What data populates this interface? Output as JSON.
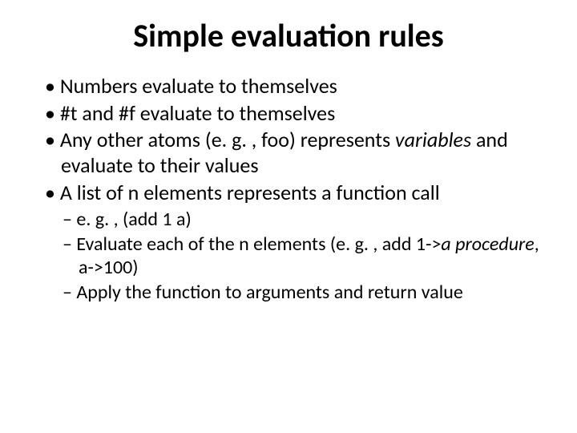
{
  "title": "Simple evaluation rules",
  "bullets": {
    "b0": "Numbers evaluate to themselves",
    "b1": "#t and #f evaluate to themselves",
    "b2_a": "Any other atoms (e. g. , foo) represents ",
    "b2_b": "variables",
    "b2_c": " and evaluate to their values",
    "b3": "A list of n elements represents a function call",
    "s0": "e. g. , (add 1 a)",
    "s1_a": "Evaluate each of the n elements (e. g. , add 1->",
    "s1_b": "a procedure",
    "s1_c": ", a->100)",
    "s2": "Apply the function to arguments and return value"
  }
}
